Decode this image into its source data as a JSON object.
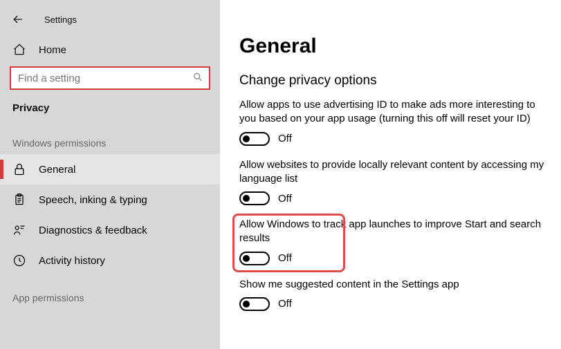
{
  "titlebar": {
    "title": "Settings"
  },
  "home": {
    "label": "Home"
  },
  "search": {
    "placeholder": "Find a setting"
  },
  "section": "Privacy",
  "categories": {
    "winperm": "Windows permissions",
    "appperm": "App permissions"
  },
  "nav": {
    "general": "General",
    "speech": "Speech, inking & typing",
    "diagnostics": "Diagnostics & feedback",
    "activity": "Activity history"
  },
  "main": {
    "title": "General",
    "subheading": "Change privacy options",
    "settings": [
      {
        "desc": "Allow apps to use advertising ID to make ads more interesting to you based on your app usage (turning this off will reset your ID)",
        "state": "Off"
      },
      {
        "desc": "Allow websites to provide locally relevant content by accessing my language list",
        "state": "Off"
      },
      {
        "desc": "Allow Windows to track app launches to improve Start and search results",
        "state": "Off"
      },
      {
        "desc": "Show me suggested content in the Settings app",
        "state": "Off"
      }
    ]
  }
}
